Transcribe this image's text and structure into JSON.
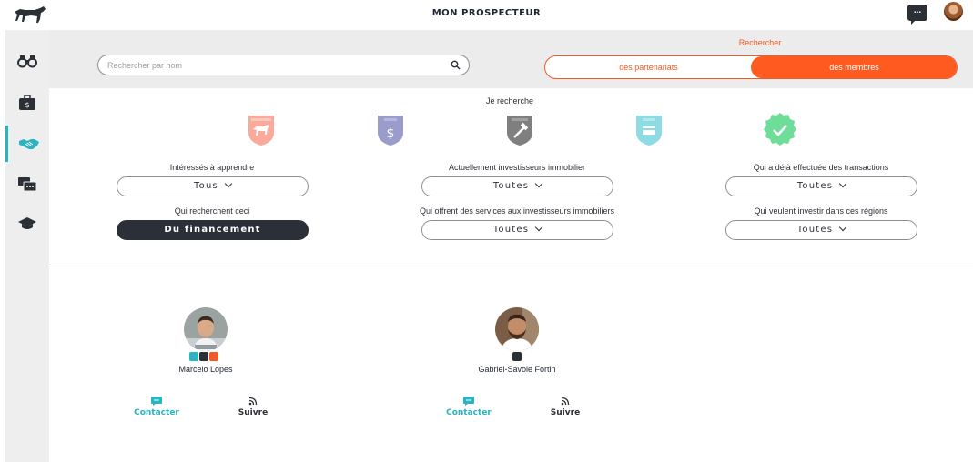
{
  "app": {
    "title": "MON PROSPECTEUR"
  },
  "topbar": {
    "chat_icon": "chat-bubble-icon",
    "chat_glyph": "...",
    "avatar": "user-avatar"
  },
  "sidebar": {
    "items": [
      {
        "name": "binoculars-icon",
        "active": false
      },
      {
        "name": "briefcase-dollar-icon",
        "active": false
      },
      {
        "name": "handshake-icon",
        "active": true
      },
      {
        "name": "chat-bubbles-icon",
        "active": false
      },
      {
        "name": "graduation-cap-icon",
        "active": false
      }
    ]
  },
  "search": {
    "placeholder": "Rechercher par nom",
    "value": ""
  },
  "mode": {
    "label": "Rechercher",
    "options": [
      "des partenariats",
      "des membres"
    ],
    "selected": "des membres"
  },
  "filters": {
    "heading": "Je recherche",
    "badges": [
      {
        "name": "prospector-badge-icon",
        "color": "#fba99a"
      },
      {
        "name": "dollar-shield-badge-icon",
        "color": "#9a9ccb"
      },
      {
        "name": "hammer-shield-badge-icon",
        "color": "#7f7f7f"
      },
      {
        "name": "card-shield-badge-icon",
        "color": "#8fdbe4"
      },
      {
        "name": "check-seal-badge-icon",
        "color": "#6fdd9a"
      }
    ],
    "interesses_label": "Intéressés à apprendre",
    "interesses_value": "Tous",
    "investisseurs_label": "Actuellement investisseurs immobilier",
    "investisseurs_value": "Toutes",
    "transactions_label": "Qui a déjà effectuée des transactions",
    "transactions_value": "Toutes",
    "recherchent_label": "Qui recherchent ceci",
    "recherchent_value": "Du financement",
    "services_label": "Qui offrent des services aux investisseurs immobiliers",
    "services_value": "Toutes",
    "regions_label": "Qui veulent investir dans ces régions",
    "regions_value": "Toutes"
  },
  "members": [
    {
      "name": "Marcelo Lopes",
      "badges": [
        "#2bb3c0",
        "#2b2f36",
        "#f15a24"
      ]
    },
    {
      "name": "Gabriel-Savoie Fortin",
      "badges": [
        "#2b2f36"
      ]
    }
  ],
  "actions": {
    "contact": "Contacter",
    "follow": "Suivre",
    "contact_color": "#2bb3c0"
  }
}
